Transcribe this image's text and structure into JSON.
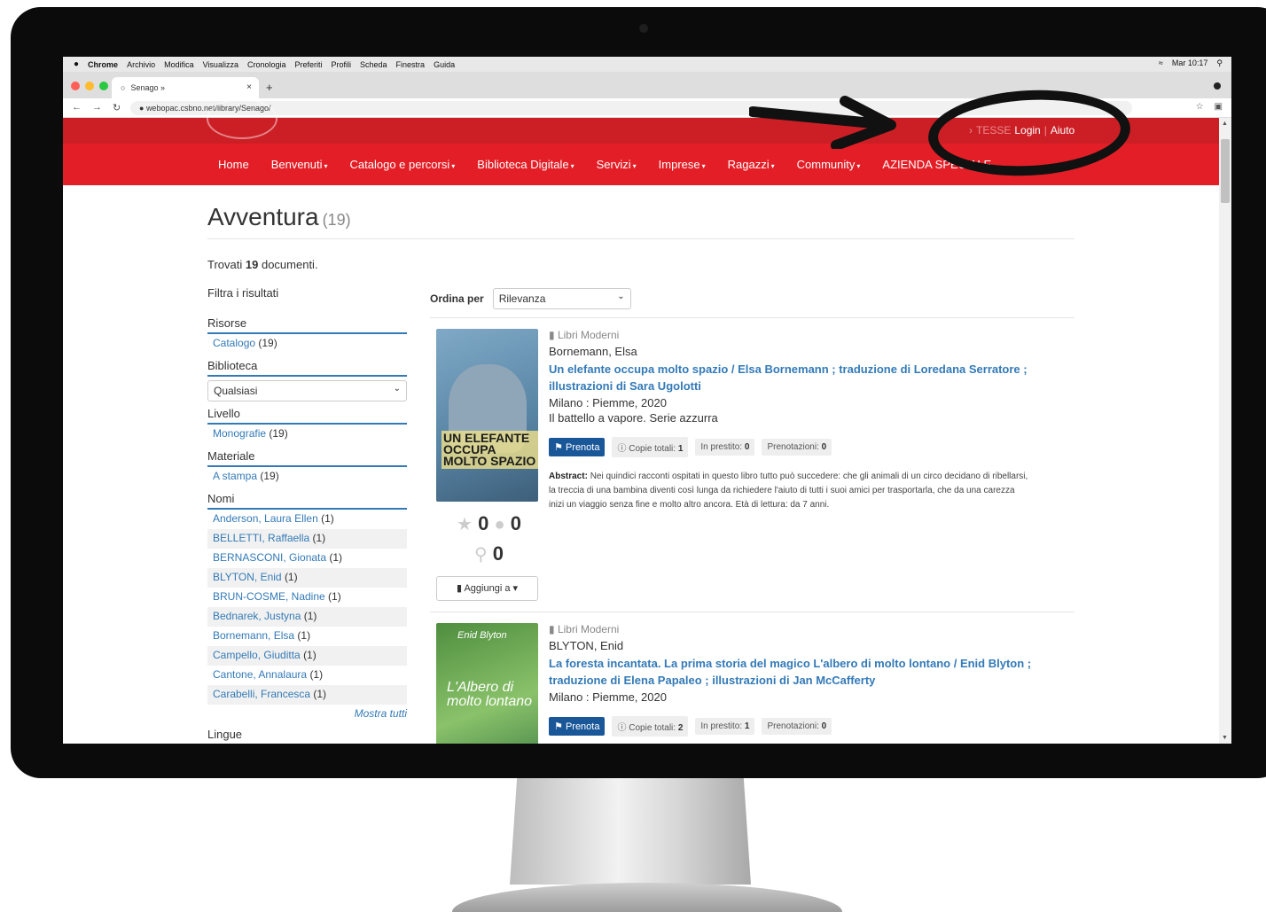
{
  "mac_menu": {
    "apple_icon": "apple-icon",
    "app_name": "Chrome",
    "items": [
      "Archivio",
      "Modifica",
      "Visualizza",
      "Cronologia",
      "Preferiti",
      "Profili",
      "Scheda",
      "Finestra",
      "Guida"
    ],
    "clock": "Mar 10:17"
  },
  "browser": {
    "tab_title": "Senago »",
    "tab_close": "×",
    "new_tab": "+",
    "url": "webopac.csbno.net/library/Senago/"
  },
  "site": {
    "top_links": {
      "faint_text": "TESSE",
      "login": "Login",
      "separator": "|",
      "help": "Aiuto"
    },
    "nav": [
      "Home",
      "Benvenuti",
      "Catalogo e percorsi",
      "Biblioteca Digitale",
      "Servizi",
      "Imprese",
      "Ragazzi",
      "Community",
      "AZIENDA SPECIALE"
    ],
    "nav_has_caret": [
      false,
      true,
      true,
      true,
      true,
      true,
      true,
      true,
      false
    ]
  },
  "page": {
    "title": "Avventura",
    "title_count": "(19)",
    "found_prefix": "Trovati",
    "found_count": "19",
    "found_suffix": "documenti.",
    "filters_label": "Filtra i risultati",
    "sort_label": "Ordina per",
    "sort_value": "Rilevanza"
  },
  "filters": {
    "risorse": {
      "label": "Risorse",
      "item": "Catalogo",
      "count": "(19)"
    },
    "biblioteca": {
      "label": "Biblioteca",
      "value": "Qualsiasi"
    },
    "livello": {
      "label": "Livello",
      "item": "Monografie",
      "count": "(19)"
    },
    "materiale": {
      "label": "Materiale",
      "item": "A stampa",
      "count": "(19)"
    },
    "nomi": {
      "label": "Nomi",
      "items": [
        {
          "name": "Anderson, Laura Ellen",
          "count": "(1)"
        },
        {
          "name": "BELLETTI, Raffaella",
          "count": "(1)"
        },
        {
          "name": "BERNASCONI, Gionata",
          "count": "(1)"
        },
        {
          "name": "BLYTON, Enid",
          "count": "(1)"
        },
        {
          "name": "BRUN-COSME, Nadine",
          "count": "(1)"
        },
        {
          "name": "Bednarek, Justyna",
          "count": "(1)"
        },
        {
          "name": "Bornemann, Elsa",
          "count": "(1)"
        },
        {
          "name": "Campello, Giuditta",
          "count": "(1)"
        },
        {
          "name": "Cantone, Annalaura",
          "count": "(1)"
        },
        {
          "name": "Carabelli, Francesca",
          "count": "(1)"
        }
      ],
      "more": "Mostra tutti"
    },
    "lingue": {
      "label": "Lingue"
    }
  },
  "records": [
    {
      "type": "Libri Moderni",
      "author": "Bornemann, Elsa",
      "title_line1": "Un elefante occupa molto spazio / Elsa Bornemann ; traduzione di Loredana Serratore ;",
      "title_line2": "illustrazioni di Sara Ugolotti",
      "publisher": "Milano : Piemme, 2020",
      "series": "Il battello a vapore. Serie azzurra",
      "cover_text": "UN ELEFANTE OCCUPA MOLTO SPAZIO",
      "prenota": "Prenota",
      "copies_label": "Copie totali:",
      "copies": "1",
      "loan_label": "In prestito:",
      "loan": "0",
      "res_label": "Prenotazioni:",
      "res": "0",
      "abstract_label": "Abstract:",
      "abstract_line1": "Nei quindici racconti ospitati in questo libro tutto può succedere: che gli animali di un circo decidano di ribellarsi,",
      "abstract_line2": "la treccia di una bambina diventi così lunga da richiedere l'aiuto di tutti i suoi amici per trasportarla, che da una carezza",
      "abstract_line3": "inizi un viaggio senza fine e molto altro ancora. Età di lettura: da 7 anni.",
      "rating": "0",
      "comments": "0",
      "locations": "0",
      "add_label": "Aggiungi a"
    },
    {
      "type": "Libri Moderni",
      "author": "BLYTON, Enid",
      "title_line1": "La foresta incantata. La prima storia del magico L'albero di molto lontano / Enid Blyton ;",
      "title_line2": "traduzione di Elena Papaleo ; illustrazioni di Jan McCafferty",
      "publisher": "Milano : Piemme, 2020",
      "cover_brand": "Enid Blyton",
      "cover_text": "L'Albero di molto lontano",
      "prenota": "Prenota",
      "copies_label": "Copie totali:",
      "copies": "2",
      "loan_label": "In prestito:",
      "loan": "1",
      "res_label": "Prenotazioni:",
      "res": "0"
    }
  ],
  "colors": {
    "brand_red": "#e41e26",
    "header_dark_red": "#cc1f25",
    "link_blue": "#337ab7",
    "button_blue": "#1a5799",
    "annotation": "#111111"
  }
}
